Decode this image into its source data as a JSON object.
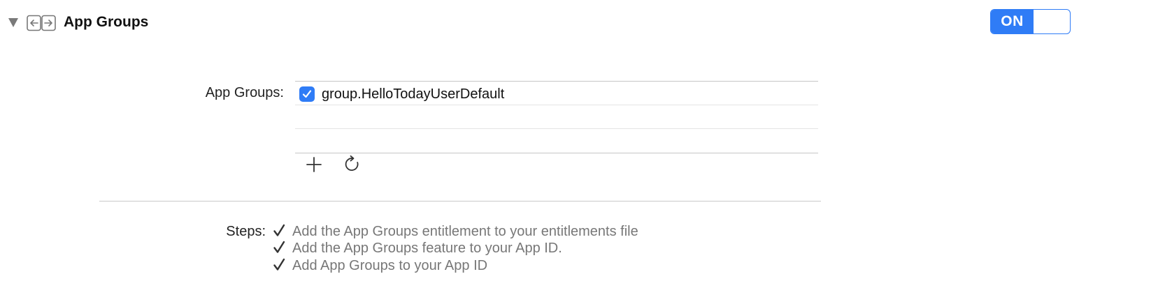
{
  "section": {
    "title": "App Groups",
    "icon": "app-groups-icon",
    "disclosure_icon": "disclosure-triangle-down-icon",
    "toggle_label": "ON"
  },
  "app_groups": {
    "label": "App Groups:",
    "items": [
      {
        "name": "group.HelloTodayUserDefault",
        "checked": true
      }
    ],
    "add_icon": "plus-icon",
    "refresh_icon": "refresh-icon"
  },
  "steps": {
    "label": "Steps:",
    "items": [
      {
        "text": "Add the App Groups entitlement to your entitlements file",
        "done": true
      },
      {
        "text": "Add the App Groups feature to your App ID.",
        "done": true
      },
      {
        "text": "Add App Groups to your App ID",
        "done": true
      }
    ]
  },
  "colors": {
    "accent": "#2f7cf6",
    "step_text": "#777777"
  }
}
